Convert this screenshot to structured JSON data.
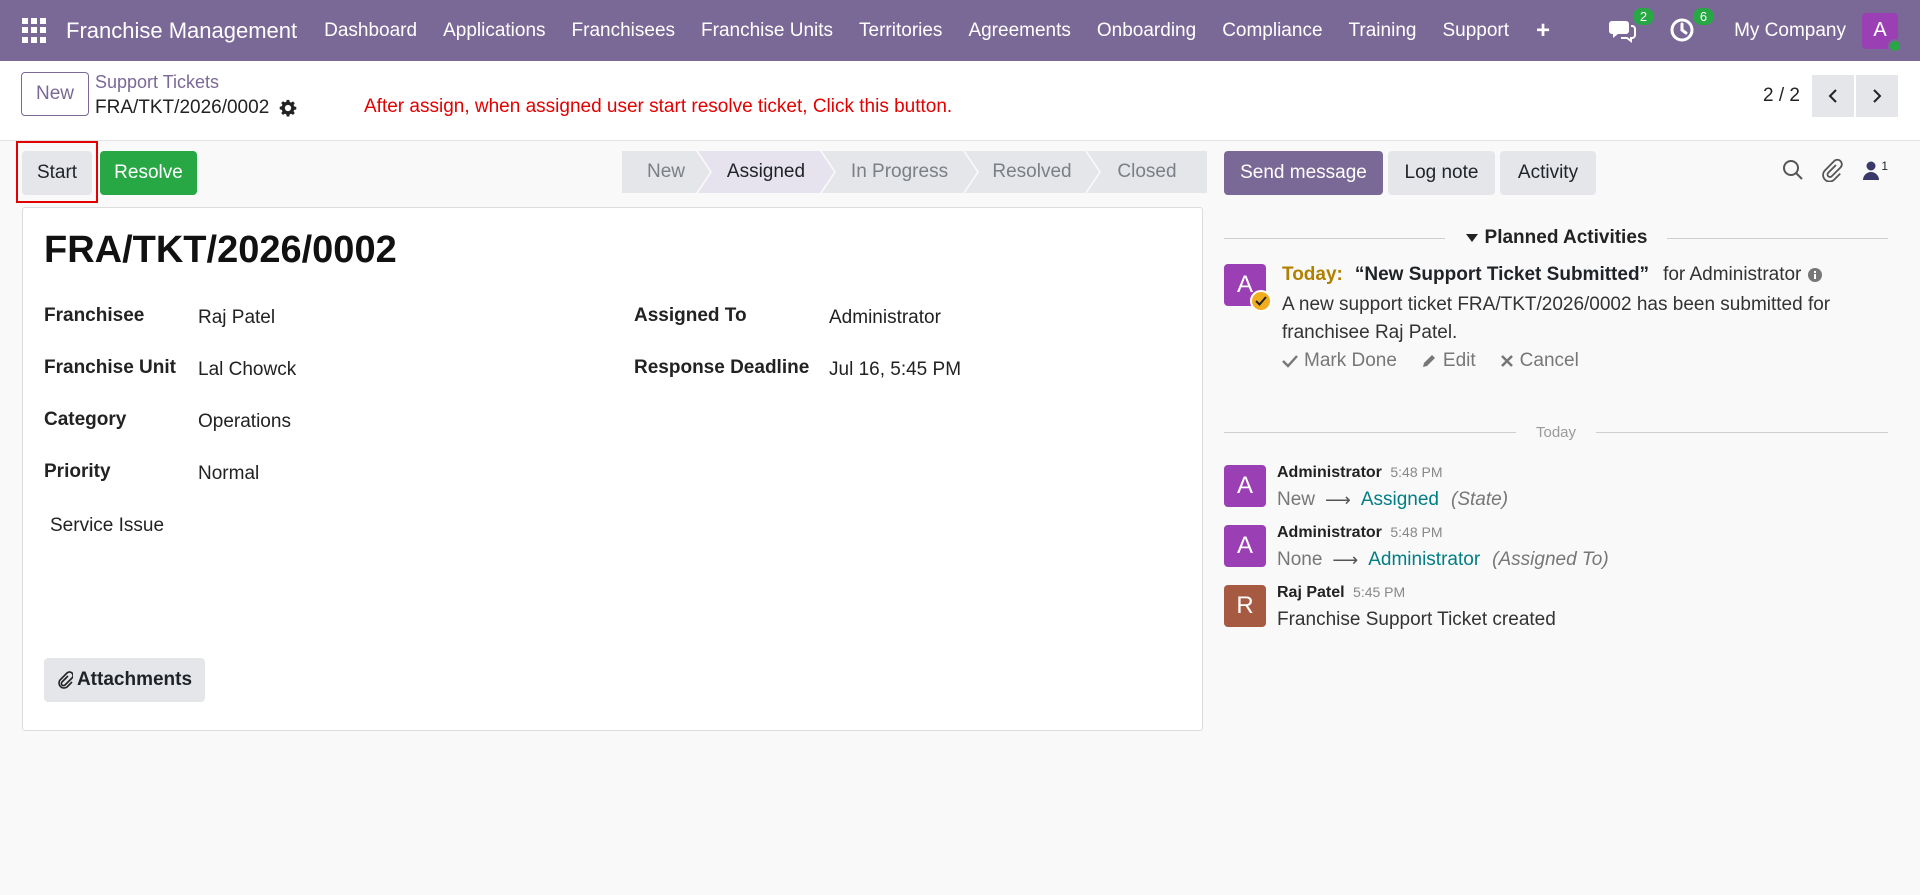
{
  "navbar": {
    "brand": "Franchise Management",
    "menu": [
      "Dashboard",
      "Applications",
      "Franchisees",
      "Franchise Units",
      "Territories",
      "Agreements",
      "Onboarding",
      "Compliance",
      "Training",
      "Support"
    ],
    "plus": "+",
    "messages_count": "2",
    "activities_count": "6",
    "company": "My Company",
    "user_initial": "A"
  },
  "control": {
    "new_label": "New",
    "breadcrumb_parent": "Support Tickets",
    "breadcrumb_current": "FRA/TKT/2026/0002",
    "annotation": "After assign, when assigned user start resolve ticket, Click this button.",
    "pager": "2 / 2"
  },
  "actions": {
    "start": "Start",
    "resolve": "Resolve"
  },
  "stages": [
    {
      "label": "New",
      "active": false
    },
    {
      "label": "Assigned",
      "active": true
    },
    {
      "label": "In Progress",
      "active": false
    },
    {
      "label": "Resolved",
      "active": false
    },
    {
      "label": "Closed",
      "active": false
    }
  ],
  "record": {
    "title": "FRA/TKT/2026/0002",
    "franchisee_label": "Franchisee",
    "franchisee": "Raj Patel",
    "unit_label": "Franchise Unit",
    "unit": "Lal Chowck",
    "category_label": "Category",
    "category": "Operations",
    "priority_label": "Priority",
    "priority": "Normal",
    "subject": "Service Issue",
    "assigned_label": "Assigned To",
    "assigned": "Administrator",
    "deadline_label": "Response Deadline",
    "deadline": "Jul 16, 5:45 PM",
    "attachments": "Attachments"
  },
  "chatter": {
    "send_message": "Send message",
    "log_note": "Log note",
    "activity": "Activity",
    "followers": "1",
    "planned_header": "Planned Activities",
    "activity_item": {
      "initial": "A",
      "when": "Today:",
      "title": "“New Support Ticket Submitted”",
      "for": "for Administrator",
      "description": "A new support ticket FRA/TKT/2026/0002 has been submitted for franchisee Raj Patel.",
      "mark_done": "Mark Done",
      "edit": "Edit",
      "cancel": "Cancel"
    },
    "today_label": "Today",
    "messages": [
      {
        "initial": "A",
        "author": "Administrator",
        "time": "5:48 PM",
        "old": "New",
        "new": "Assigned",
        "field": "(State)"
      },
      {
        "initial": "A",
        "author": "Administrator",
        "time": "5:48 PM",
        "old": "None",
        "new": "Administrator",
        "field": "(Assigned To)"
      },
      {
        "initial": "R",
        "author": "Raj Patel",
        "time": "5:45 PM",
        "text": "Franchise Support Ticket created"
      }
    ]
  },
  "colors": {
    "brand": "#7a6996",
    "success": "#28a745",
    "annotation": "#e30000",
    "link": "#017e84"
  }
}
